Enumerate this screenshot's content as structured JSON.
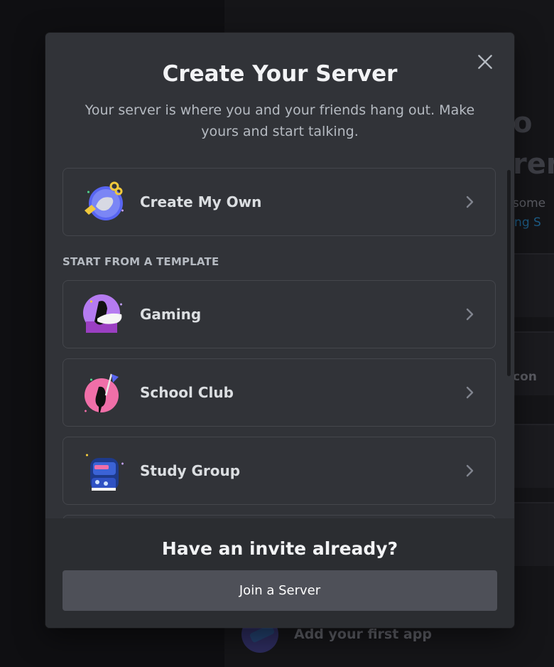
{
  "background": {
    "fragments": [
      "o",
      "ren",
      "e some",
      "tting S",
      "con"
    ],
    "app_row_label": "Add your first app"
  },
  "modal": {
    "title": "Create Your Server",
    "subtitle": "Your server is where you and your friends hang out. Make yours and start talking.",
    "create_own": {
      "label": "Create My Own",
      "icon": "create-own-illustration"
    },
    "template_header": "START FROM A TEMPLATE",
    "templates": [
      {
        "label": "Gaming",
        "icon": "gaming-illustration"
      },
      {
        "label": "School Club",
        "icon": "school-club-illustration"
      },
      {
        "label": "Study Group",
        "icon": "study-group-illustration"
      }
    ],
    "footer": {
      "title": "Have an invite already?",
      "button_label": "Join a Server"
    }
  },
  "colors": {
    "modal_bg": "#313338",
    "footer_bg": "#2b2d31",
    "button_bg": "#4e5058",
    "title_text": "#f2f3f5",
    "muted_text": "#b5bac1"
  }
}
